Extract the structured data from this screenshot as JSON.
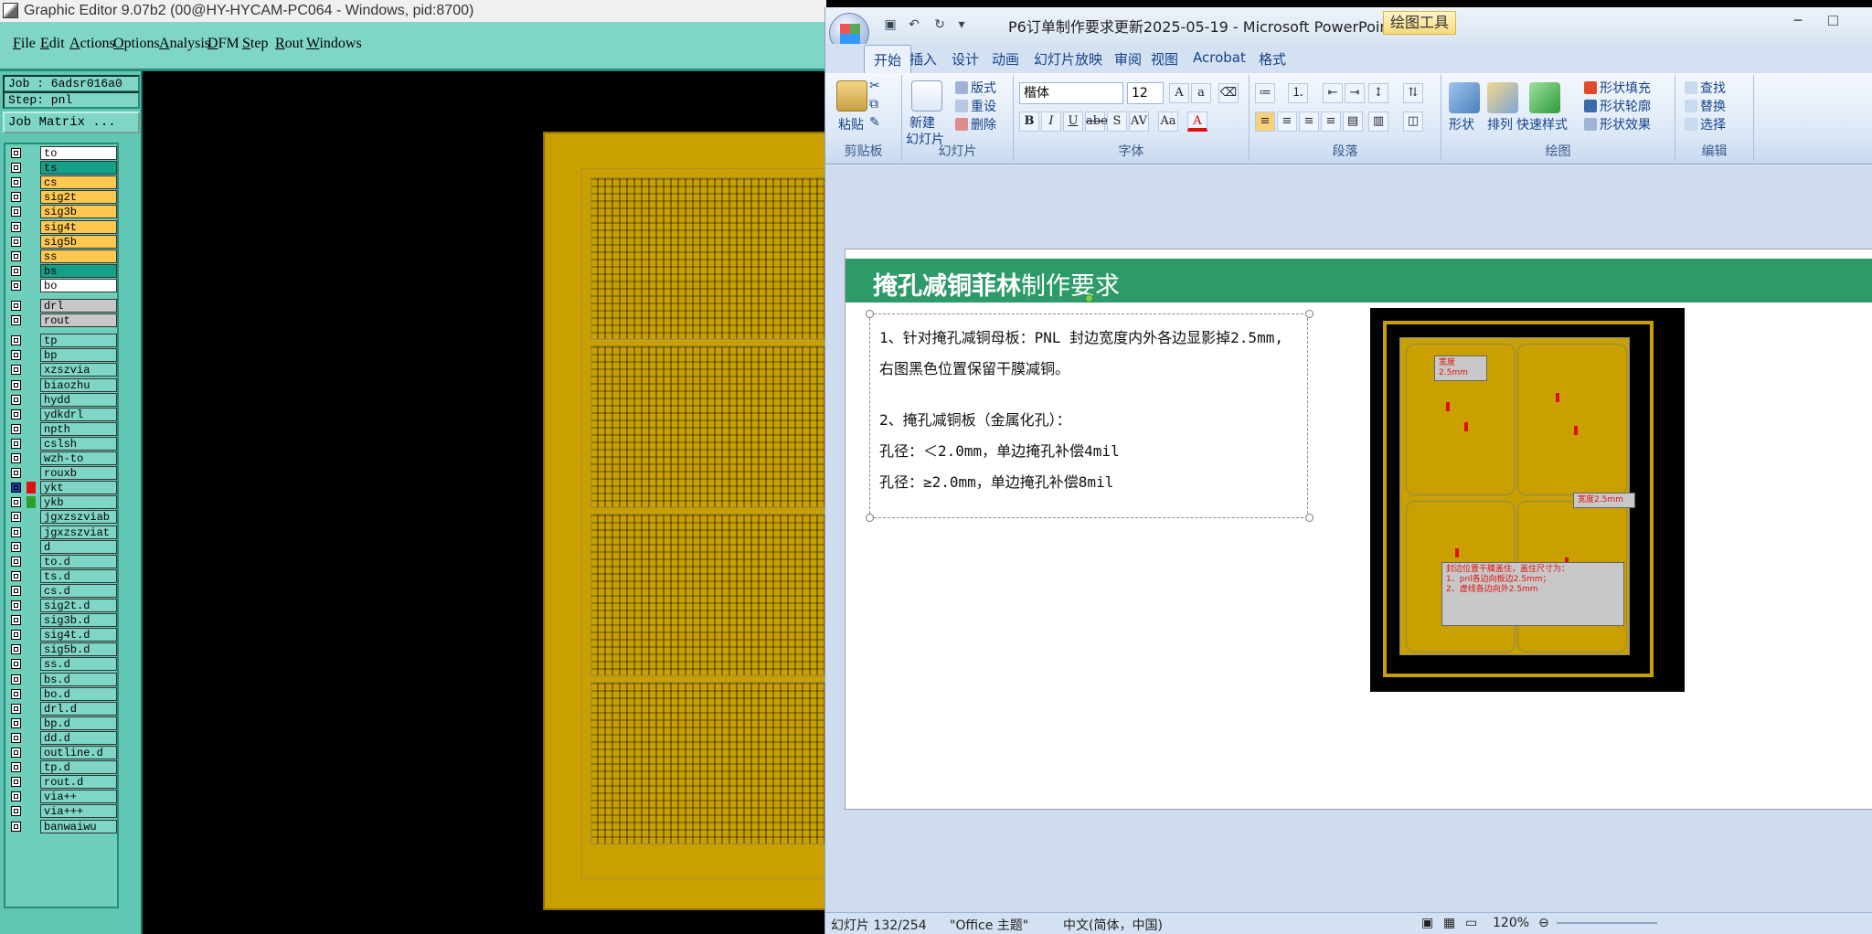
{
  "graphic_editor": {
    "title": "Graphic Editor 9.07b2 (00@HY-HYCAM-PC064 - Windows, pid:8700)",
    "menu": [
      {
        "label": "File",
        "u": "F",
        "rest": "ile"
      },
      {
        "label": "Edit",
        "u": "E",
        "rest": "dit"
      },
      {
        "label": "Actions",
        "u": "A",
        "rest": "ctions"
      },
      {
        "label": "Options",
        "u": "O",
        "rest": "ptions"
      },
      {
        "label": "Analysis",
        "u": "A",
        "rest": "nalysis"
      },
      {
        "label": "DFM",
        "u": "D",
        "rest": "FM"
      },
      {
        "label": "Step",
        "u": "S",
        "rest": "tep"
      },
      {
        "label": "Rout",
        "u": "R",
        "rest": "out"
      },
      {
        "label": "Windows",
        "u": "W",
        "rest": "indows"
      }
    ],
    "job": "Job : 6adsr016a0",
    "step": "Step: pnl",
    "job_matrix": "Job Matrix ...",
    "layers": [
      {
        "name": "to",
        "color": "#ffffff"
      },
      {
        "name": "ts",
        "color": "#15a089"
      },
      {
        "name": "cs",
        "color": "#ffc850"
      },
      {
        "name": "sig2t",
        "color": "#ffc850"
      },
      {
        "name": "sig3b",
        "color": "#ffc850"
      },
      {
        "name": "sig4t",
        "color": "#ffc850"
      },
      {
        "name": "sig5b",
        "color": "#ffc850"
      },
      {
        "name": "ss",
        "color": "#ffc850"
      },
      {
        "name": "bs",
        "color": "#15a089"
      },
      {
        "name": "bo",
        "color": "#ffffff"
      },
      {
        "name": "drl",
        "color": "#c8c8c8",
        "gap": true
      },
      {
        "name": "rout",
        "color": "#c8c8c8"
      },
      {
        "name": "tp",
        "color": "#7fd6c6",
        "gap": true
      },
      {
        "name": "bp",
        "color": "#7fd6c6"
      },
      {
        "name": "xzszvia",
        "color": "#7fd6c6"
      },
      {
        "name": "biaozhu",
        "color": "#7fd6c6"
      },
      {
        "name": "hydd",
        "color": "#7fd6c6"
      },
      {
        "name": "ydkdrl",
        "color": "#7fd6c6"
      },
      {
        "name": "npth",
        "color": "#7fd6c6"
      },
      {
        "name": "cslsh",
        "color": "#7fd6c6"
      },
      {
        "name": "wzh-to",
        "color": "#7fd6c6"
      },
      {
        "name": "rouxb",
        "color": "#7fd6c6"
      },
      {
        "name": "ykt",
        "color": "#7fd6c6",
        "sw": "#e01010",
        "checked": true
      },
      {
        "name": "ykb",
        "color": "#7fd6c6",
        "sw": "#2ca02c"
      },
      {
        "name": "jgxzszviab",
        "color": "#7fd6c6"
      },
      {
        "name": "jgxzszviat",
        "color": "#7fd6c6"
      },
      {
        "name": "d",
        "color": "#7fd6c6"
      },
      {
        "name": "to.d",
        "color": "#7fd6c6"
      },
      {
        "name": "ts.d",
        "color": "#7fd6c6"
      },
      {
        "name": "cs.d",
        "color": "#7fd6c6"
      },
      {
        "name": "sig2t.d",
        "color": "#7fd6c6"
      },
      {
        "name": "sig3b.d",
        "color": "#7fd6c6"
      },
      {
        "name": "sig4t.d",
        "color": "#7fd6c6"
      },
      {
        "name": "sig5b.d",
        "color": "#7fd6c6"
      },
      {
        "name": "ss.d",
        "color": "#7fd6c6"
      },
      {
        "name": "bs.d",
        "color": "#7fd6c6"
      },
      {
        "name": "bo.d",
        "color": "#7fd6c6"
      },
      {
        "name": "drl.d",
        "color": "#7fd6c6"
      },
      {
        "name": "bp.d",
        "color": "#7fd6c6"
      },
      {
        "name": "dd.d",
        "color": "#7fd6c6"
      },
      {
        "name": "outline.d",
        "color": "#7fd6c6"
      },
      {
        "name": "tp.d",
        "color": "#7fd6c6"
      },
      {
        "name": "rout.d",
        "color": "#7fd6c6"
      },
      {
        "name": "via++",
        "color": "#7fd6c6"
      },
      {
        "name": "via+++",
        "color": "#7fd6c6"
      },
      {
        "name": "banwaiwu",
        "color": "#7fd6c6"
      }
    ]
  },
  "powerpoint": {
    "title": "P6订单制作要求更新2025-05-19 - Microsoft PowerPoint",
    "context_tab": "绘图工具",
    "tabs": [
      "开始",
      "插入",
      "设计",
      "动画",
      "幻灯片放映",
      "审阅",
      "视图",
      "Acrobat",
      "格式"
    ],
    "ribbon": {
      "clipboard": {
        "paste": "粘贴",
        "label": "剪贴板"
      },
      "slides": {
        "new_slide": "新建",
        "new_slide2": "幻灯片",
        "layout": "版式",
        "reset": "重设",
        "delete": "删除",
        "label": "幻灯片"
      },
      "font": {
        "name": "楷体",
        "size": "12",
        "label": "字体"
      },
      "paragraph": {
        "label": "段落"
      },
      "drawing": {
        "shapes": "形状",
        "arrange": "排列",
        "quick_styles": "快速样式",
        "fill": "形状填充",
        "outline": "形状轮廓",
        "effects": "形状效果",
        "label": "绘图"
      },
      "editing": {
        "find": "查找",
        "replace": "替换",
        "select": "选择",
        "label": "编辑"
      }
    },
    "slide": {
      "title_bold": "掩孔减铜菲林",
      "title_rest": "制作要求",
      "lines": [
        "1、针对掩孔减铜母板：PNL 封边宽度内外各边显影掉2.5mm,",
        "   右图黑色位置保留干膜减铜。",
        "2、掩孔减铜板（金属化孔）：",
        "   孔径：＜2.0mm，单边掩孔补偿4mil",
        "   孔径：≥2.0mm，单边掩孔补偿8mil"
      ],
      "callout_top": "宽度2.5mm",
      "callout_right": "宽度2.5mm",
      "callout_note": [
        "封边位置干膜盖住，盖住尺寸为：",
        "1、pnl各边向板边2.5mm；",
        "2、虚线各边向外2.5mm"
      ]
    },
    "status": {
      "slide": "幻灯片 132/254",
      "theme": "\"Office 主题\"",
      "lang": "中文(简体，中国)",
      "zoom": "120%"
    }
  },
  "colors": {
    "ge_menu": "#7fd6c6",
    "ge_panel": "#5fc7b3",
    "pcb_gold": "#c9a000",
    "slide_header": "#2e9a6a",
    "callout_red": "#e01010"
  }
}
